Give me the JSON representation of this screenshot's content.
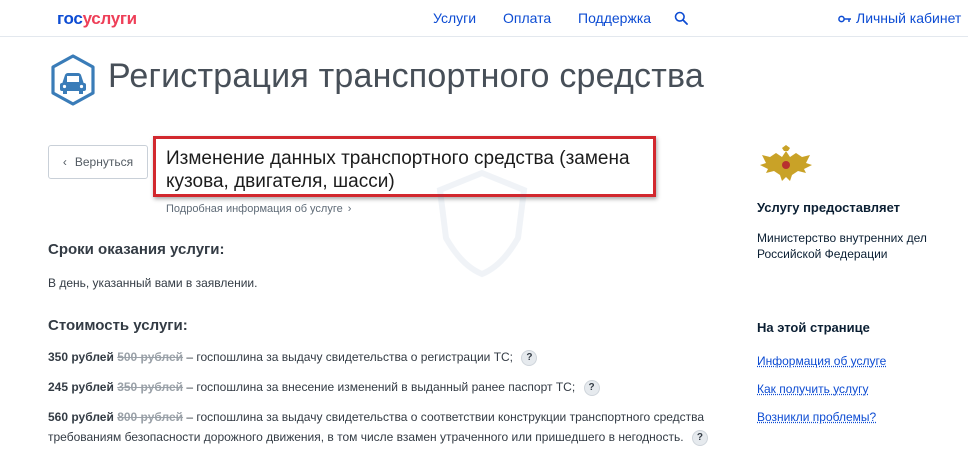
{
  "header": {
    "logo_part1": "гос",
    "logo_part2": "услуги",
    "nav": [
      "Услуги",
      "Оплата",
      "Поддержка"
    ],
    "cabinet_label": "Личный кабинет"
  },
  "page": {
    "title": "Регистрация транспортного средства",
    "back_label": "Вернуться",
    "subtitle": "Изменение данных транспортного средства (замена кузова, двигателя, шасси)",
    "more_info": "Подробная информация об услуге"
  },
  "terms": {
    "heading": "Сроки оказания услуги:",
    "text": "В день, указанный вами в заявлении."
  },
  "cost": {
    "heading": "Стоимость услуги:",
    "items": [
      {
        "price": "350 рублей",
        "old_price": "500 рублей",
        "desc": " – госпошлина за выдачу свидетельства о регистрации ТС;"
      },
      {
        "price": "245 рублей",
        "old_price": "350 рублей",
        "desc": " – госпошлина за внесение изменений в выданный ранее паспорт ТС;"
      },
      {
        "price": "560 рублей",
        "old_price": "800 рублей",
        "desc": " – госпошлина за выдачу свидетельства о соответствии конструкции транспортного средства требованиям безопасности дорожного движения, в том числе взамен утраченного или пришедшего в негодность."
      }
    ],
    "help_symbol": "?"
  },
  "sidebar": {
    "provider_heading": "Услугу предоставляет",
    "provider_name": "Министерство внутренних дел Российской Федерации",
    "toc_heading": "На этой странице",
    "links": [
      "Информация об услуге",
      "Как получить услугу",
      "Возникли проблемы?"
    ]
  },
  "colors": {
    "brand_blue": "#0d4cd3",
    "brand_red": "#ee3f58",
    "highlight_border": "#d2282e"
  }
}
